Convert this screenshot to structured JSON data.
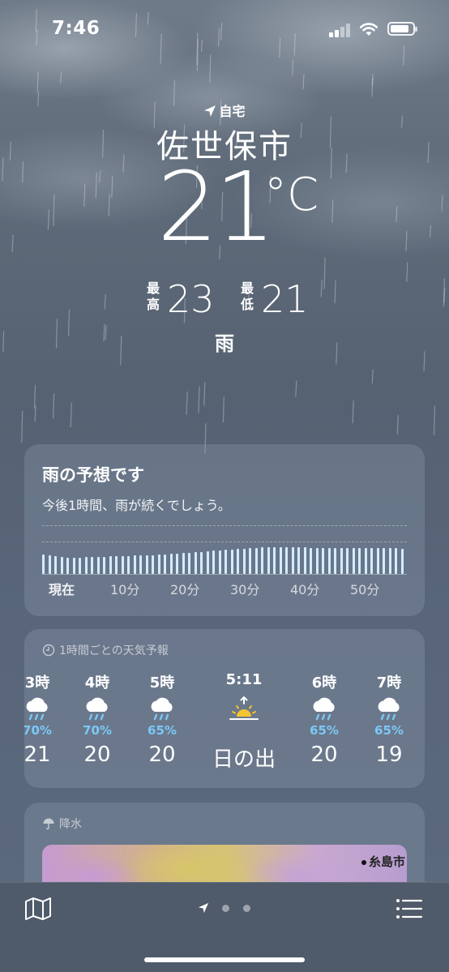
{
  "status_bar": {
    "time": "7:46"
  },
  "header": {
    "location_tag": "自宅",
    "city": "佐世保市",
    "temperature": "21",
    "temperature_unit": "°C",
    "high_label_1": "最",
    "high_label_2": "高",
    "high_value": "23",
    "low_label_1": "最",
    "low_label_2": "低",
    "low_value": "21",
    "condition": "雨"
  },
  "precip_forecast": {
    "title": "雨の予想です",
    "description": "今後1時間、雨が続くでしょう。",
    "ticks": [
      "現在",
      "10分",
      "20分",
      "30分",
      "40分",
      "50分"
    ]
  },
  "hourly": {
    "label": "1時間ごとの天気予報",
    "items": [
      {
        "hour": "3時",
        "icon": "rain-cloud-icon",
        "chance": "70%",
        "temp": "21"
      },
      {
        "hour": "4時",
        "icon": "rain-cloud-icon",
        "chance": "70%",
        "temp": "20"
      },
      {
        "hour": "5時",
        "icon": "rain-cloud-icon",
        "chance": "65%",
        "temp": "20"
      },
      {
        "hour": "5:11",
        "icon": "sunrise-icon",
        "chance": "",
        "temp": "日の出"
      },
      {
        "hour": "6時",
        "icon": "rain-cloud-icon",
        "chance": "65%",
        "temp": "20"
      },
      {
        "hour": "7時",
        "icon": "rain-cloud-icon",
        "chance": "65%",
        "temp": "19"
      }
    ]
  },
  "precipitation_map": {
    "label": "降水",
    "place": "糸島市"
  },
  "colors": {
    "accent_rain": "#7cc8f5",
    "bar": "#d3ecff"
  }
}
